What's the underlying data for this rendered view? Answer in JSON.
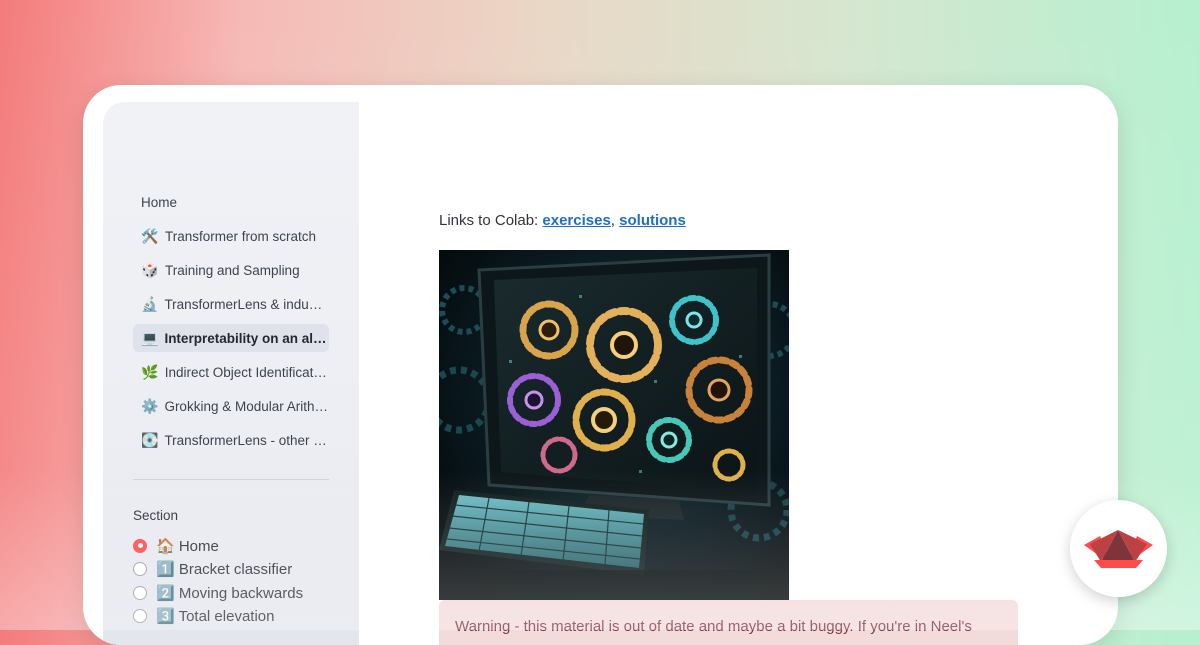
{
  "sidebar": {
    "nav_items": [
      {
        "icon": "",
        "label": "Home"
      },
      {
        "icon": "🛠️",
        "label": "Transformer from scratch"
      },
      {
        "icon": "🎲",
        "label": "Training and Sampling"
      },
      {
        "icon": "🔬",
        "label": "TransformerLens & induction circuits"
      },
      {
        "icon": "💻",
        "label": "Interpretability on an algorithmic model"
      },
      {
        "icon": "🌿",
        "label": "Indirect Object Identification"
      },
      {
        "icon": "⚙️",
        "label": "Grokking & Modular Arithmetic"
      },
      {
        "icon": "💽",
        "label": "TransformerLens - other features"
      }
    ],
    "section_title": "Section",
    "section_options": [
      {
        "label": "🏠 Home",
        "selected": true
      },
      {
        "label": "1️⃣ Bracket classifier",
        "selected": false
      },
      {
        "label": "2️⃣ Moving backwards",
        "selected": false
      },
      {
        "label": "3️⃣ Total elevation",
        "selected": false
      }
    ]
  },
  "main": {
    "links_prefix": "Links to Colab: ",
    "link_exercises": "exercises",
    "link_separator": ", ",
    "link_solutions": "solutions",
    "warning_text": "Warning - this material is out of date and maybe a bit buggy. If you're in Neel's"
  },
  "colors": {
    "accent": "#ff4b4b",
    "link": "#1c6fc2",
    "warning_bg": "#f4dbdb",
    "warning_text": "#7d353b"
  }
}
